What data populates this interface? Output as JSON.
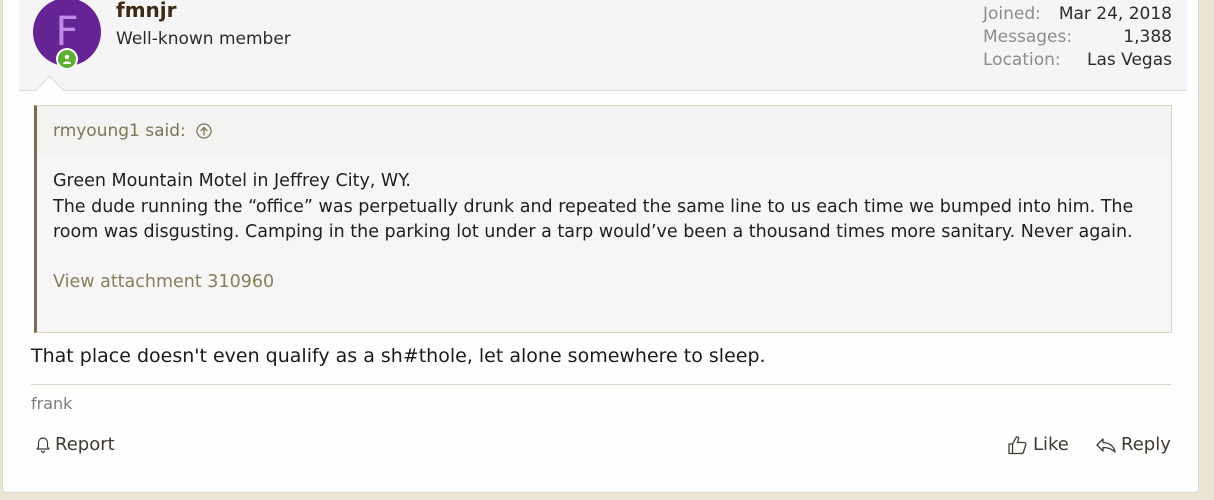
{
  "user": {
    "avatar_letter": "F",
    "avatar_color": "#642493",
    "username": "fmnjr",
    "title": "Well-known member",
    "online_status_icon": "user-online-icon"
  },
  "stats": [
    {
      "label": "Joined:",
      "value": "Mar 24, 2018"
    },
    {
      "label": "Messages:",
      "value": "1,388"
    },
    {
      "label": "Location:",
      "value": "Las Vegas"
    }
  ],
  "quote": {
    "author_said": "rmyoung1 said:",
    "jump_icon": "arrow-up-circle-icon",
    "line1": "Green Mountain Motel in Jeffrey City, WY.",
    "line2": "The dude running the “office” was perpetually drunk and repeated the same line to us each time we bumped into him. The room was disgusting. Camping in the parking lot under a tarp would’ve been a thousand times more sanitary. Never again.",
    "attachment": "View attachment 310960"
  },
  "post": {
    "body": "That place doesn't even qualify as a sh#thole, let alone somewhere to sleep.",
    "signature": "frank"
  },
  "actions": {
    "report": "Report",
    "like": "Like",
    "reply": "Reply"
  },
  "colors": {
    "page_bg": "#ece5d3",
    "accent": "#7e6b4f",
    "online": "#5fae35"
  }
}
